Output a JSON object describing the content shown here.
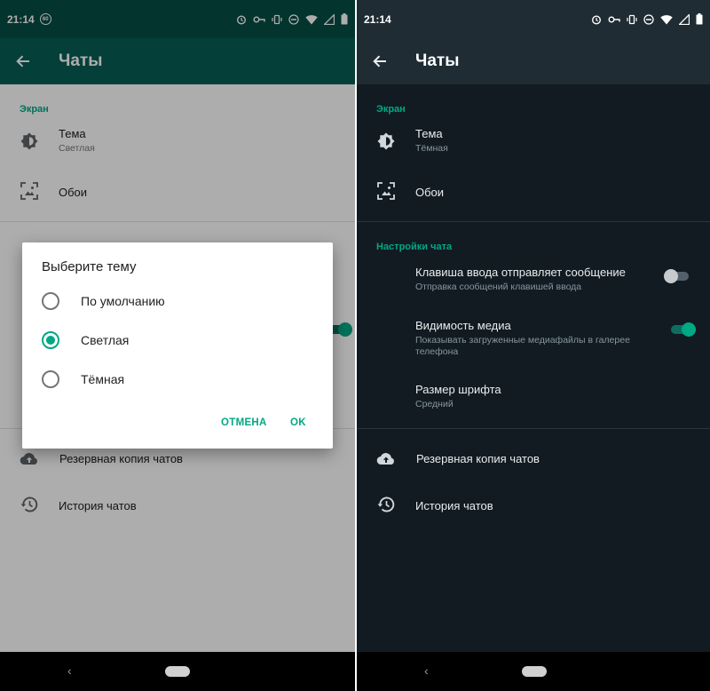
{
  "status_bar": {
    "time": "21:14",
    "badge": "60"
  },
  "app_bar": {
    "title": "Чаты"
  },
  "sections": {
    "screen": "Экран",
    "chat_settings": "Настройки чата"
  },
  "left": {
    "theme": {
      "title": "Тема",
      "value": "Светлая"
    },
    "wallpaper": {
      "title": "Обои"
    },
    "backup": {
      "title": "Резервная копия чатов"
    },
    "history": {
      "title": "История чатов"
    },
    "dialog": {
      "title": "Выберите тему",
      "options": [
        {
          "label": "По умолчанию",
          "selected": false
        },
        {
          "label": "Светлая",
          "selected": true
        },
        {
          "label": "Тёмная",
          "selected": false
        }
      ],
      "cancel": "ОТМЕНА",
      "ok": "OK"
    }
  },
  "right": {
    "theme": {
      "title": "Тема",
      "value": "Тёмная"
    },
    "wallpaper": {
      "title": "Обои"
    },
    "enter_send": {
      "title": "Клавиша ввода отправляет сообщение",
      "subtitle": "Отправка сообщений клавишей ввода",
      "enabled": false
    },
    "media_visibility": {
      "title": "Видимость медиа",
      "subtitle_line1": "Показывать загруженные медиафайлы в галерее",
      "subtitle_line2": "телефона",
      "enabled": true
    },
    "font_size": {
      "title": "Размер шрифта",
      "value": "Средний"
    },
    "backup": {
      "title": "Резервная копия чатов"
    },
    "history": {
      "title": "История чатов"
    }
  },
  "colors": {
    "accent": "#00a884",
    "light_status": "#054d44",
    "light_appbar": "#075e54",
    "dark_bg": "#121b22",
    "dark_appbar": "#1f2c34"
  },
  "icons": [
    "back-arrow-icon",
    "brightness-icon",
    "wallpaper-icon",
    "cloud-upload-icon",
    "history-icon",
    "alarm-icon",
    "vpn-key-icon",
    "vibrate-icon",
    "dnd-icon",
    "wifi-icon",
    "battery-icon"
  ]
}
